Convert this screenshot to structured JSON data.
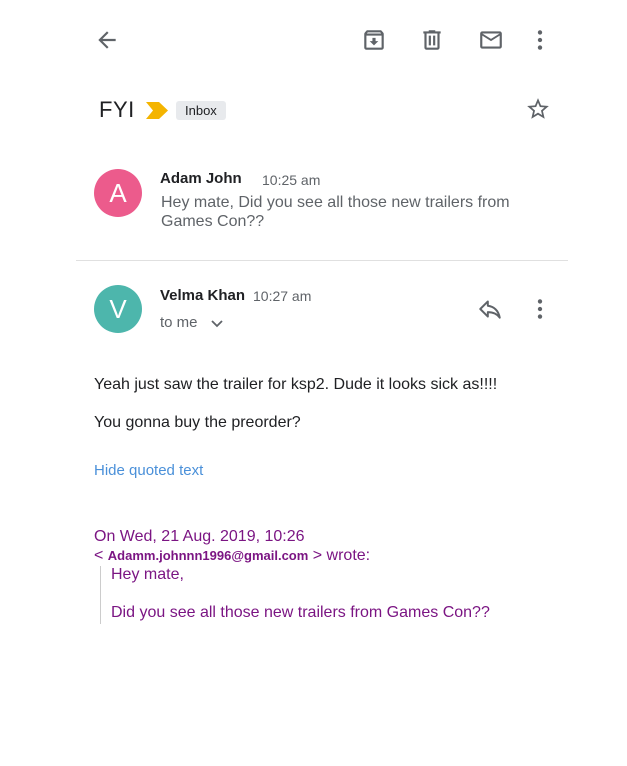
{
  "toolbar": {
    "back_icon": "arrow-back-icon",
    "archive_icon": "archive-icon",
    "delete_icon": "delete-icon",
    "mark_unread_icon": "mail-icon",
    "more_icon": "more-vert-icon"
  },
  "thread": {
    "subject": "FYI",
    "label": "Inbox",
    "important_color": "#f4b400",
    "starred": false
  },
  "messages": [
    {
      "avatar_letter": "A",
      "avatar_color": "#ec5b8c",
      "sender": "Adam John",
      "time": "10:25 am",
      "snippet": "Hey mate, Did you see all those new trailers from Games Con??"
    },
    {
      "avatar_letter": "V",
      "avatar_color": "#4db6ac",
      "sender": "Velma Khan",
      "time": "10:27 am",
      "recipient": "to me",
      "body": [
        "Yeah just saw the trailer for ksp2. Dude it looks sick as!!!!",
        "You gonna buy the preorder?"
      ],
      "hide_quoted_label": "Hide quoted text",
      "quote": {
        "header": "On Wed, 21 Aug. 2019, 10:26",
        "from_open": "< ",
        "from_email": "Adamm.johnnn1996@gmail.com",
        "from_close": " > wrote:",
        "lines": [
          "Hey mate,",
          "Did you see all those new trailers from Games Con??"
        ]
      }
    }
  ]
}
